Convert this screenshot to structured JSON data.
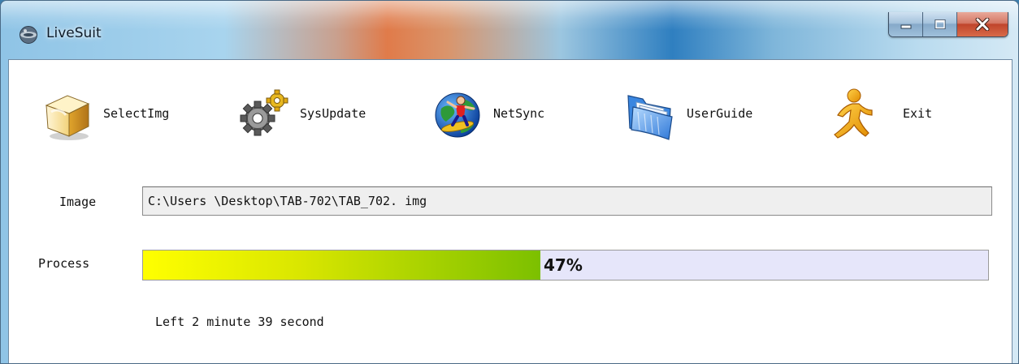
{
  "window": {
    "title": "LiveSuit",
    "app_icon": "livesuit-logo-icon",
    "caption_buttons": [
      "minimize-icon",
      "maximize-icon",
      "close-icon"
    ]
  },
  "toolbar": {
    "items": [
      {
        "label": "SelectImg",
        "icon": "package-box-icon"
      },
      {
        "label": "SysUpdate",
        "icon": "gears-icon"
      },
      {
        "label": "NetSync",
        "icon": "globe-surfer-icon"
      },
      {
        "label": "UserGuide",
        "icon": "folder-icon"
      },
      {
        "label": "Exit",
        "icon": "running-man-icon"
      }
    ]
  },
  "image": {
    "label": "Image",
    "path": "C:\\Users \\Desktop\\TAB-702\\TAB_702. img"
  },
  "process": {
    "label": "Process",
    "percent": 47,
    "percent_text": "47%",
    "fill_colors": [
      "#ffff00",
      "#7cc000"
    ],
    "track_color": "#e6e6fa"
  },
  "status": {
    "time_left": "Left 2 minute 39 second"
  }
}
